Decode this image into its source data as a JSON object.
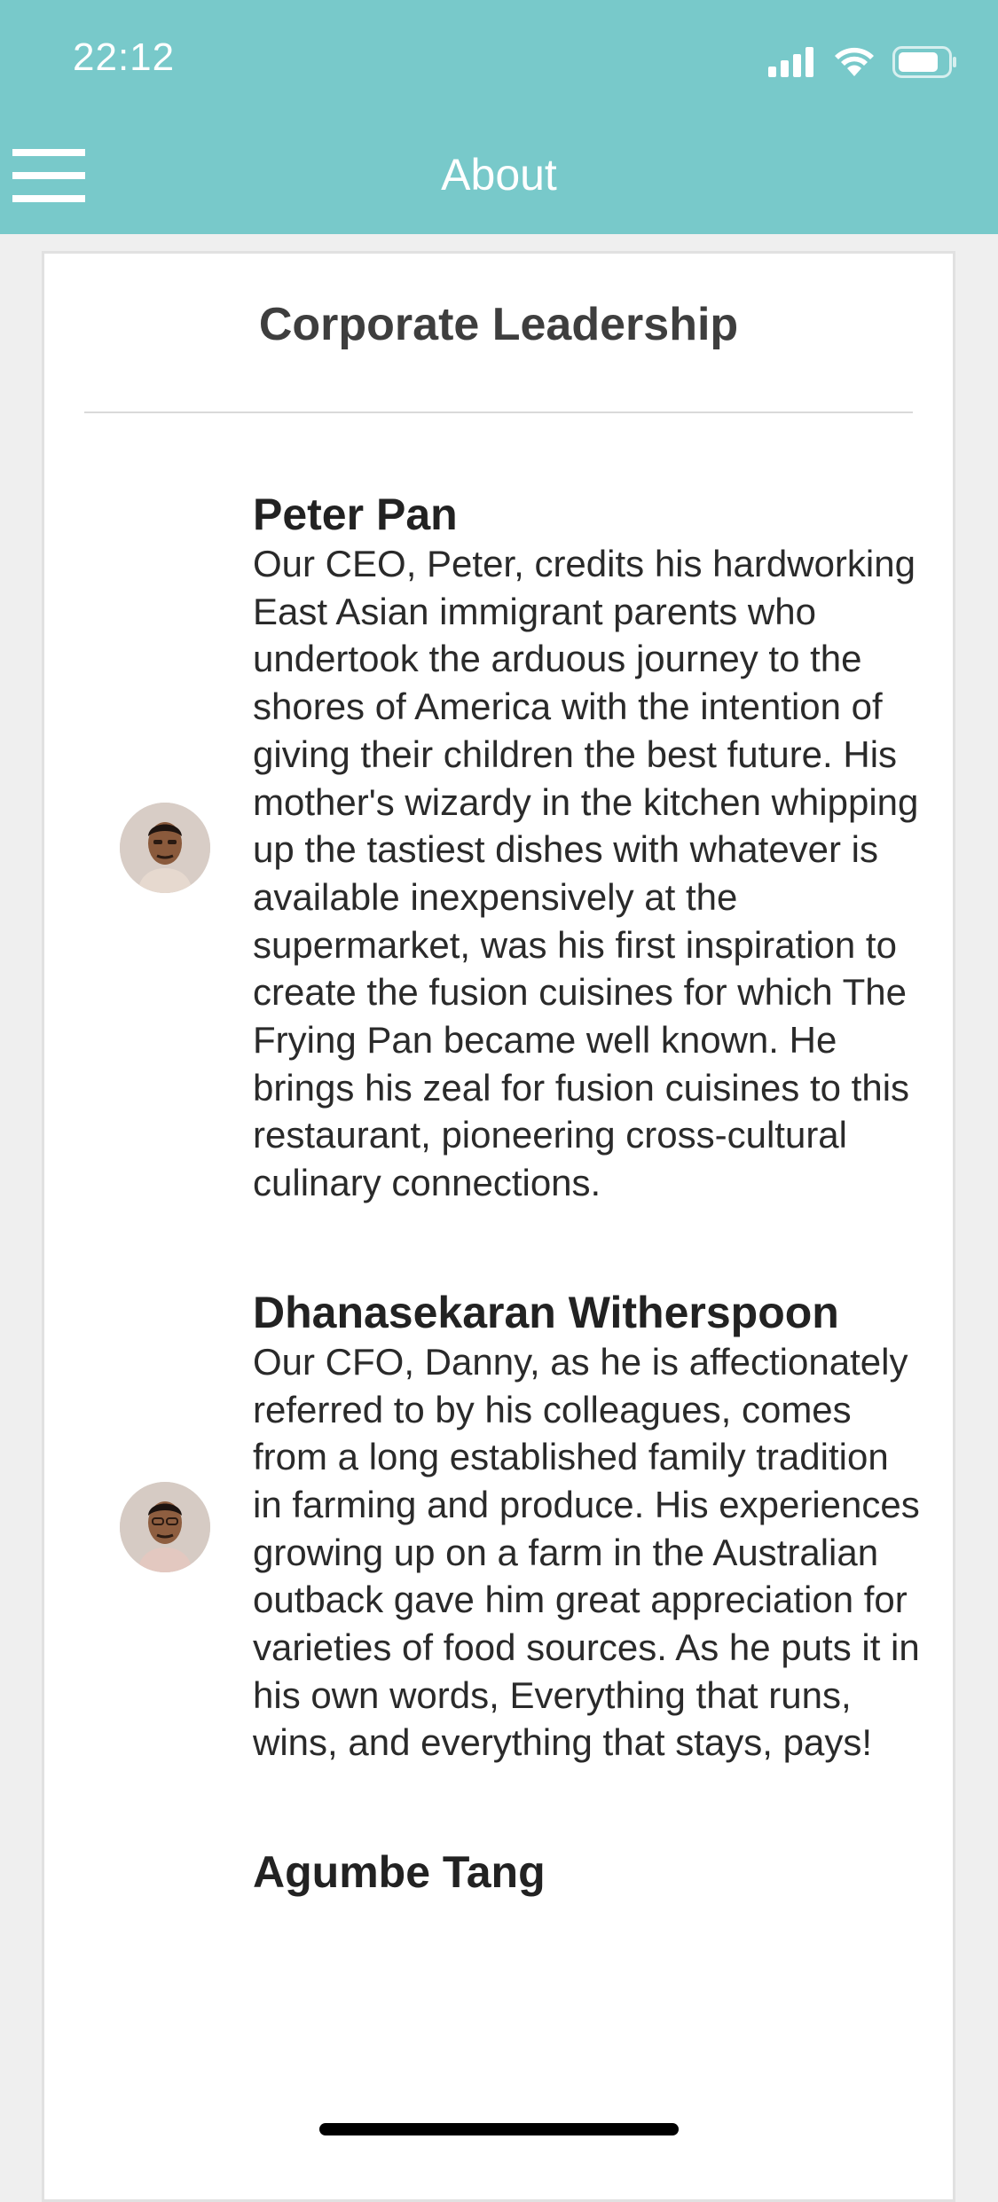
{
  "status_bar": {
    "time": "22:12"
  },
  "header": {
    "title": "About",
    "menu_icon": "hamburger-menu-icon",
    "background_color": "#78c9ca"
  },
  "section": {
    "title": "Corporate Leadership"
  },
  "leaders": [
    {
      "name": "Peter Pan",
      "bio": "Our CEO, Peter, credits his hardworking East Asian immigrant parents who undertook the arduous journey to the shores of America with the intention of giving their children the best future. His mother's wizardy in the kitchen whipping up the tastiest dishes with whatever is available inexpensively at the supermarket, was his first inspiration to create the fusion cuisines for which The Frying Pan became well known. He brings his zeal for fusion cuisines to this restaurant, pioneering cross-cultural culinary connections."
    },
    {
      "name": "Dhanasekaran Witherspoon",
      "bio": "Our CFO, Danny, as he is affectionately referred to by his colleagues, comes from a long established family tradition in farming and produce. His experiences growing up on a farm in the Australian outback gave him great appreciation for varieties of food sources. As he puts it in his own words, Everything that runs, wins, and everything that stays, pays!"
    },
    {
      "name": "Agumbe Tang"
    }
  ]
}
